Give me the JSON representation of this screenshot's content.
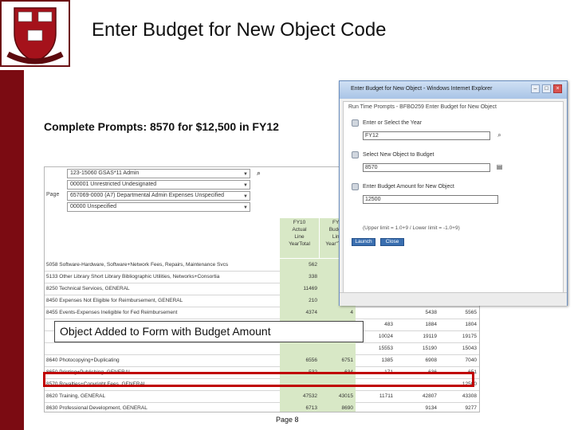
{
  "slide": {
    "title": "Enter Budget for New Object Code",
    "subtitle": "Complete Prompts: 8570 for $12,500 in FY12",
    "callout": "Object Added to Form with Budget Amount",
    "page_number": "Page 8"
  },
  "colors": {
    "crimson": "#7b0b12",
    "highlight": "#c00000",
    "grid_green": "#d8e8c6"
  },
  "sheet": {
    "page_label": "Page",
    "prompts": [
      "123-15060 GSAS*11 Admin",
      "000001 Unrestricted Undesignated",
      "657069-0000 (A7) Departmental Admin Expenses Unspecified",
      "00000 Unspecified"
    ],
    "headers": [
      [
        "FY10",
        "Actual",
        "Line",
        "YearTotal"
      ],
      [
        "FY1",
        "Budget",
        "Line",
        "Year\"Total"
      ],
      [
        "",
        "",
        "",
        ""
      ],
      [
        "",
        "",
        "",
        ""
      ],
      [
        "",
        "",
        "",
        ""
      ]
    ],
    "rows": [
      {
        "label": "5058 Software-Hardware, Software+Network Fees, Repairs, Maintenance Svcs",
        "c": [
          "562",
          "",
          "",
          "",
          ""
        ]
      },
      {
        "label": "5133 Other Library Short Library Bibliographic Utilities, Networks+Consortia",
        "c": [
          "338",
          "",
          "",
          "",
          ""
        ]
      },
      {
        "label": "8250 Technical Services, GENERAL",
        "c": [
          "11469",
          "11",
          "",
          "",
          ""
        ]
      },
      {
        "label": "8450 Expenses Not Eligible for Reimbursement, GENERAL",
        "c": [
          "210",
          "",
          "",
          "",
          ""
        ]
      },
      {
        "label": "8455 Events-Expenses Ineligible for Fed Reimbursement",
        "c": [
          "4374",
          "4",
          "",
          "5438",
          "5565"
        ]
      },
      {
        "label": "",
        "c": [
          "",
          "",
          "483",
          "1884",
          "1804"
        ]
      },
      {
        "label": "",
        "c": [
          "",
          "",
          "10024",
          "19119",
          "19175"
        ]
      },
      {
        "label": "",
        "c": [
          "",
          "",
          "15553",
          "15190",
          "15043"
        ]
      },
      {
        "label": "8640 Photocopying+Duplicating",
        "c": [
          "6556",
          "6751",
          "1385",
          "6908",
          "7040"
        ]
      },
      {
        "label": "8650 Printing+Publishing, GENERAL",
        "c": [
          "532",
          "634",
          "171",
          "636",
          "651"
        ]
      },
      {
        "label": "8570 Royalties+Copyright Fees, GENERAL",
        "c": [
          "",
          "",
          "",
          "",
          "12500"
        ]
      },
      {
        "label": "8620 Training, GENERAL",
        "c": [
          "47532",
          "43015",
          "11711",
          "42807",
          "43308"
        ]
      },
      {
        "label": "8630 Professional Development, GENERAL",
        "c": [
          "6713",
          "8690",
          "",
          "9134",
          "9277"
        ]
      }
    ]
  },
  "dialog": {
    "title": "Enter Budget for New Object - Windows Internet Explorer",
    "run_prompts": "Run Time Prompts - BFBO259 Enter Budget for New Object",
    "fields": [
      {
        "label": "Enter or Select the Year",
        "value": "FY12"
      },
      {
        "label": "Select New Object to Budget",
        "value": "8570"
      },
      {
        "label": "Enter Budget Amount for New Object",
        "value": "12500"
      }
    ],
    "hint": "(Upper limit = 1.0+9 / Lower limit = -1.0+9)",
    "launch_label": "Launch",
    "close_label": "Close",
    "win_minimize": "–",
    "win_maximize": "□",
    "win_close": "×"
  }
}
